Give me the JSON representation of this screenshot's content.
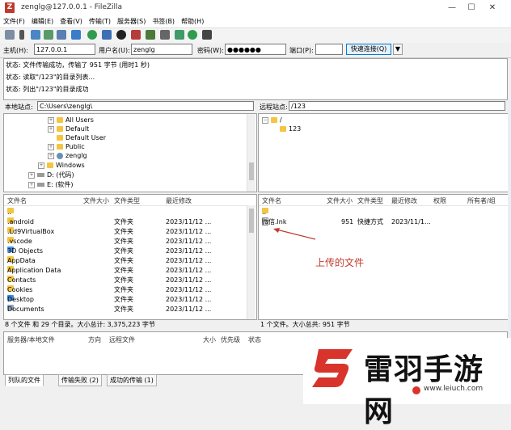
{
  "window": {
    "app_icon": "filezilla-icon",
    "title": "zenglg@127.0.0.1 - FileZilla",
    "minimize": "—",
    "maximize": "☐",
    "close": "✕"
  },
  "menu": [
    "文件(F)",
    "编辑(E)",
    "查看(V)",
    "传输(T)",
    "服务器(S)",
    "书签(B)",
    "帮助(H)"
  ],
  "quickconnect": {
    "host_label": "主机(H):",
    "host_value": "127.0.0.1",
    "user_label": "用户名(U):",
    "user_value": "zenglg",
    "pass_label": "密码(W):",
    "pass_value": "●●●●●●",
    "port_label": "端口(P):",
    "port_value": "",
    "connect_label": "快速连接(Q)",
    "dropdown": "▼"
  },
  "log": [
    "状态: 文件传输成功，传输了 951 字节 (用时1 秒)",
    "状态: 读取\"/123\"的目录列表...",
    "状态: 列出\"/123\"的目录成功"
  ],
  "local": {
    "site_label": "本地站点:",
    "site_path": "C:\\Users\\zenglg\\",
    "tree": [
      {
        "name": "All Users",
        "type": "folder"
      },
      {
        "name": "Default",
        "type": "folder"
      },
      {
        "name": "Default User",
        "type": "folder"
      },
      {
        "name": "Public",
        "type": "folder"
      },
      {
        "name": "zenglg",
        "type": "user"
      },
      {
        "name": "Windows",
        "type": "folder"
      },
      {
        "name": "D: (代码)",
        "type": "drive"
      },
      {
        "name": "E: (软件)",
        "type": "drive"
      }
    ],
    "columns": [
      "文件名",
      "文件大小",
      "文件类型",
      "最近修改"
    ],
    "files": [
      {
        "name": "..",
        "size": "",
        "type": "",
        "modified": ""
      },
      {
        "name": ".android",
        "size": "",
        "type": "文件夹",
        "modified": "2023/11/12 ..."
      },
      {
        "name": ".Ld9VirtualBox",
        "size": "",
        "type": "文件夹",
        "modified": "2023/11/12 ..."
      },
      {
        "name": ".vscode",
        "size": "",
        "type": "文件夹",
        "modified": "2023/11/12 ..."
      },
      {
        "name": "3D Objects",
        "size": "",
        "type": "文件夹",
        "modified": "2023/11/12 ..."
      },
      {
        "name": "AppData",
        "size": "",
        "type": "文件夹",
        "modified": "2023/11/12 ..."
      },
      {
        "name": "Application Data",
        "size": "",
        "type": "文件夹",
        "modified": "2023/11/12 ..."
      },
      {
        "name": "Contacts",
        "size": "",
        "type": "文件夹",
        "modified": "2023/11/12 ..."
      },
      {
        "name": "Cookies",
        "size": "",
        "type": "文件夹",
        "modified": "2023/11/12 ..."
      },
      {
        "name": "Desktop",
        "size": "",
        "type": "文件夹",
        "modified": "2023/11/12 ..."
      },
      {
        "name": "Documents",
        "size": "",
        "type": "文件夹",
        "modified": "2023/11/12 ..."
      }
    ],
    "status": "8 个文件 和 29 个目录。大小总计: 3,375,223 字节"
  },
  "remote": {
    "site_label": "远程站点:",
    "site_path": "/123",
    "tree": [
      {
        "name": "/",
        "type": "folder"
      },
      {
        "name": "123",
        "type": "folder"
      }
    ],
    "columns": [
      "文件名",
      "文件大小",
      "文件类型",
      "最近修改",
      "权限",
      "所有者/组"
    ],
    "files": [
      {
        "name": "..",
        "size": "",
        "type": "",
        "modified": ""
      },
      {
        "name": "微信.lnk",
        "size": "951",
        "type": "快捷方式",
        "modified": "2023/11/1..."
      }
    ],
    "status": "1 个文件。大小总共: 951 字节"
  },
  "queue": {
    "columns": [
      "服务器/本地文件",
      "方向",
      "远程文件",
      "大小",
      "优先级",
      "状态"
    ]
  },
  "tabs": [
    "列队的文件",
    "传输失败 (2)",
    "成功的传输 (1)"
  ],
  "annotation": "上传的文件",
  "watermark": {
    "brand": "雷羽手游网",
    "url": "www.leiuch.com",
    "accent": "#d9342b"
  }
}
